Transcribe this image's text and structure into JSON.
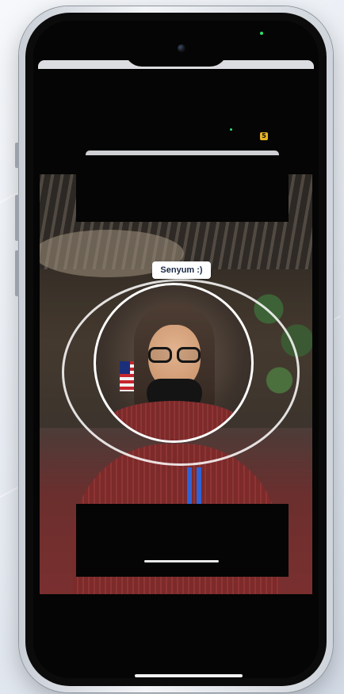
{
  "app": {
    "prompt_label": "Senyum :)",
    "inner_status_badge": "5"
  },
  "colors": {
    "prompt_text": "#1b2a45",
    "ring": "#ffffff",
    "badge": "#e7b521",
    "status_led": "#2ee06b"
  },
  "icons": {
    "front_camera": "camera-icon",
    "face_guide": "circle-outline-icon"
  }
}
